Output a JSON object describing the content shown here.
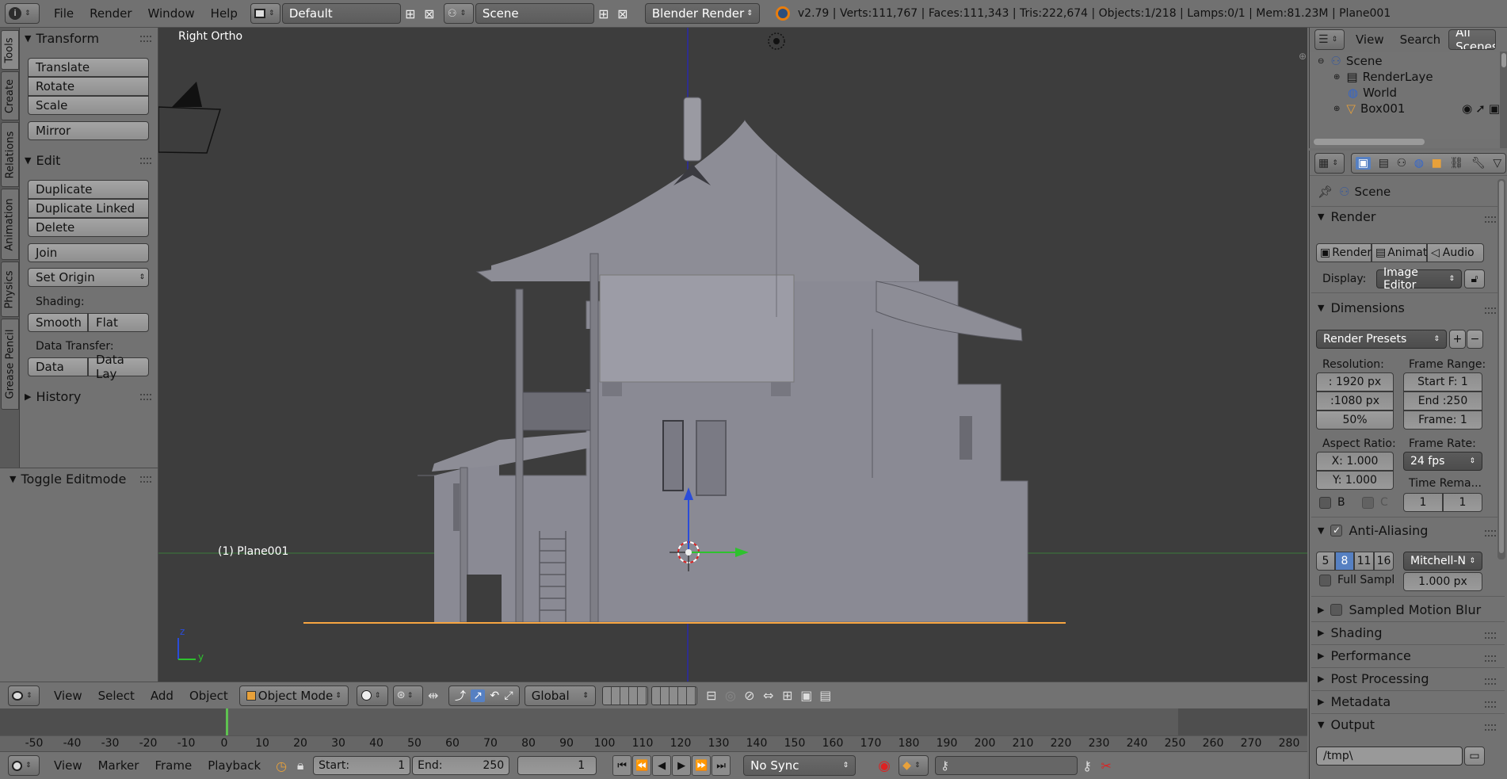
{
  "topbar": {
    "menus": [
      "File",
      "Render",
      "Window",
      "Help"
    ],
    "layout": "Default",
    "scene": "Scene",
    "engine": "Blender Render",
    "stats": "v2.79 | Verts:111,767 | Faces:111,343 | Tris:222,674 | Objects:1/218 | Lamps:0/1 | Mem:81.23M | Plane001"
  },
  "tabs": [
    "Tools",
    "Create",
    "Relations",
    "Animation",
    "Physics",
    "Grease Pencil"
  ],
  "toolshelf": {
    "transform_title": "Transform",
    "translate": "Translate",
    "rotate": "Rotate",
    "scale": "Scale",
    "mirror": "Mirror",
    "edit_title": "Edit",
    "duplicate": "Duplicate",
    "duplicate_linked": "Duplicate Linked",
    "delete": "Delete",
    "join": "Join",
    "set_origin": "Set Origin",
    "shading_label": "Shading:",
    "smooth": "Smooth",
    "flat": "Flat",
    "data_transfer_label": "Data Transfer:",
    "data": "Data",
    "data_lay": "Data Lay",
    "history_title": "History",
    "toggle_editmode": "Toggle Editmode"
  },
  "viewport": {
    "view_name": "Right Ortho",
    "object_label": "(1) Plane001",
    "axis_z": "z",
    "axis_y": "y"
  },
  "vp_header": {
    "view": "View",
    "select": "Select",
    "add": "Add",
    "object": "Object",
    "mode": "Object Mode",
    "orientation": "Global"
  },
  "timeline": {
    "ticks": [
      "-50",
      "-40",
      "-30",
      "-20",
      "-10",
      "0",
      "10",
      "20",
      "30",
      "40",
      "50",
      "60",
      "70",
      "80",
      "90",
      "100",
      "110",
      "120",
      "130",
      "140",
      "150",
      "160",
      "170",
      "180",
      "190",
      "200",
      "210",
      "220",
      "230",
      "240",
      "250",
      "260",
      "270",
      "280"
    ],
    "view": "View",
    "marker": "Marker",
    "frame": "Frame",
    "playback": "Playback",
    "start_label": "Start:",
    "start_value": "1",
    "end_label": "End:",
    "end_value": "250",
    "current": "1",
    "sync": "No Sync"
  },
  "outliner": {
    "view": "View",
    "search": "Search",
    "all_scenes": "All Scenes",
    "items": [
      "Scene",
      "RenderLaye",
      "World",
      "Box001"
    ]
  },
  "properties": {
    "context": "Scene",
    "render_title": "Render",
    "render_btn": "Render",
    "animat_btn": "Animat",
    "audio_btn": "Audio",
    "display_label": "Display:",
    "display_value": "Image Editor",
    "dimensions_title": "Dimensions",
    "render_presets": "Render Presets",
    "resolution_label": "Resolution:",
    "res_x": ": 1920 px",
    "res_y": ":1080 px",
    "res_pct": "50%",
    "frame_range_label": "Frame Range:",
    "start_f": "Start F: 1",
    "end_f": "End :250",
    "frame_f": "Frame: 1",
    "aspect_label": "Aspect Ratio:",
    "aspect_x": "X:  1.000",
    "aspect_y": "Y:  1.000",
    "framerate_label": "Frame Rate:",
    "fps": "24 fps",
    "time_remap_label": "Time Rema...",
    "remap_old": "1",
    "remap_new": "1",
    "b_label": "B",
    "c_label": "C",
    "aa_title": "Anti-Aliasing",
    "aa_samples": [
      "5",
      "8",
      "11",
      "16"
    ],
    "aa_filter": "Mitchell-N",
    "full_sample": "Full Sampl",
    "filter_size": "1.000 px",
    "motion_blur": "Sampled Motion Blur",
    "shading": "Shading",
    "performance": "Performance",
    "post_processing": "Post Processing",
    "metadata": "Metadata",
    "output": "Output",
    "output_path": "/tmp\\"
  },
  "colors": {
    "accent": "#5680c2",
    "viewport_bg": "#3d3d3d",
    "panel_bg": "#727272",
    "selection": "#f7a541"
  }
}
